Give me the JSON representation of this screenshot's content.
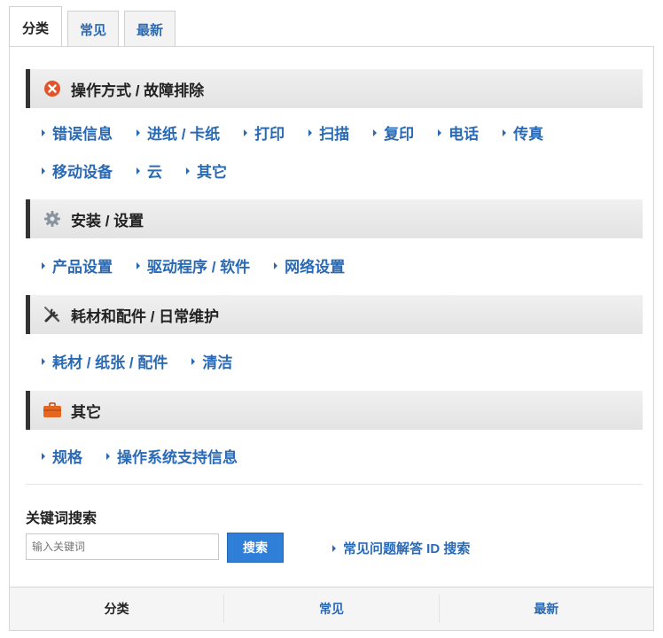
{
  "tabs": [
    {
      "label": "分类",
      "active": true
    },
    {
      "label": "常见",
      "active": false
    },
    {
      "label": "最新",
      "active": false
    }
  ],
  "sections": [
    {
      "title": "操作方式 / 故障排除",
      "icon": "error-icon",
      "rows": [
        [
          "错误信息",
          "进纸 / 卡纸",
          "打印",
          "扫描",
          "复印",
          "电话",
          "传真"
        ],
        [
          "移动设备",
          "云",
          "其它"
        ]
      ]
    },
    {
      "title": "安装 / 设置",
      "icon": "gear-icon",
      "rows": [
        [
          "产品设置",
          "驱动程序 / 软件",
          "网络设置"
        ]
      ]
    },
    {
      "title": "耗材和配件 / 日常维护",
      "icon": "tools-icon",
      "rows": [
        [
          "耗材 / 纸张 / 配件",
          "清洁"
        ]
      ]
    },
    {
      "title": "其它",
      "icon": "briefcase-icon",
      "rows": [
        [
          "规格",
          "操作系统支持信息"
        ]
      ]
    }
  ],
  "search": {
    "title": "关键词搜索",
    "placeholder": "输入关键词",
    "button": "搜索",
    "faq_link": "常见问题解答 ID 搜索"
  },
  "bottom_tabs": [
    {
      "label": "分类",
      "active": true
    },
    {
      "label": "常见",
      "active": false
    },
    {
      "label": "最新",
      "active": false
    }
  ],
  "colors": {
    "link": "#2a6ab5",
    "button": "#2f7fd8",
    "error_icon": "#e2542b",
    "briefcase_icon": "#e5661f"
  }
}
